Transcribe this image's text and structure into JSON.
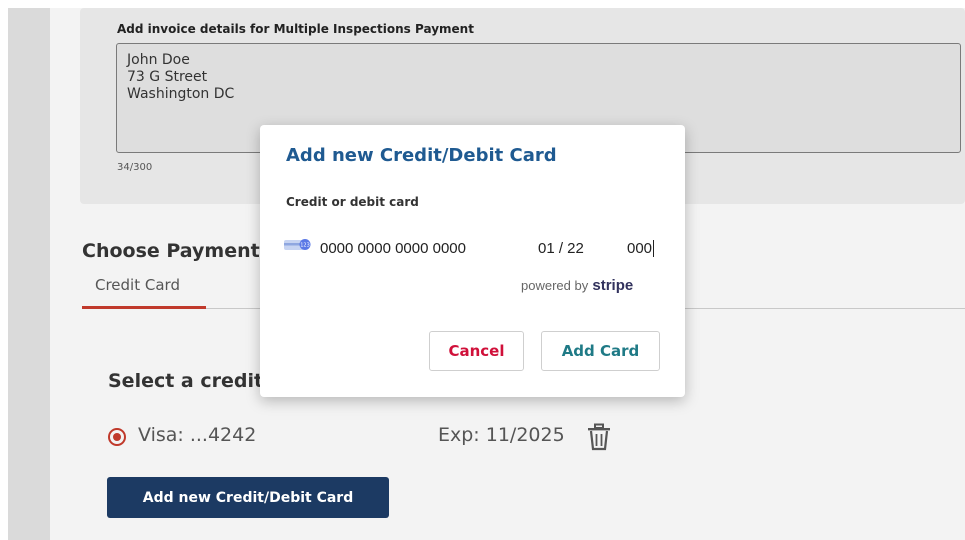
{
  "invoice": {
    "label": "Add invoice details for Multiple Inspections Payment",
    "value": "John Doe\n73 G Street\nWashington DC",
    "counter": "34/300"
  },
  "payment": {
    "title": "Choose Payment",
    "tab_credit_card": "Credit Card",
    "select_title": "Select a credit card",
    "saved_card": {
      "label": "Visa: ...4242",
      "expiry": "Exp: 11/2025"
    },
    "add_new_button": "Add new Credit/Debit Card"
  },
  "modal": {
    "title": "Add new Credit/Debit Card",
    "field_label": "Credit or debit card",
    "card_number": "0000 0000 0000 0000",
    "expiry": "01 / 22",
    "cvc": "000",
    "powered_by": "powered by",
    "stripe": "stripe",
    "cancel_button": "Cancel",
    "add_button": "Add Card"
  },
  "icons": {
    "card_brand": "generic-card-icon",
    "trash": "trash-icon",
    "radio": "radio-selected"
  },
  "colors": {
    "accent_red": "#c0392b",
    "primary_navy": "#1c3a63",
    "modal_title_blue": "#1f5a91",
    "cancel_red": "#d0103a",
    "add_teal": "#1f7a86"
  }
}
